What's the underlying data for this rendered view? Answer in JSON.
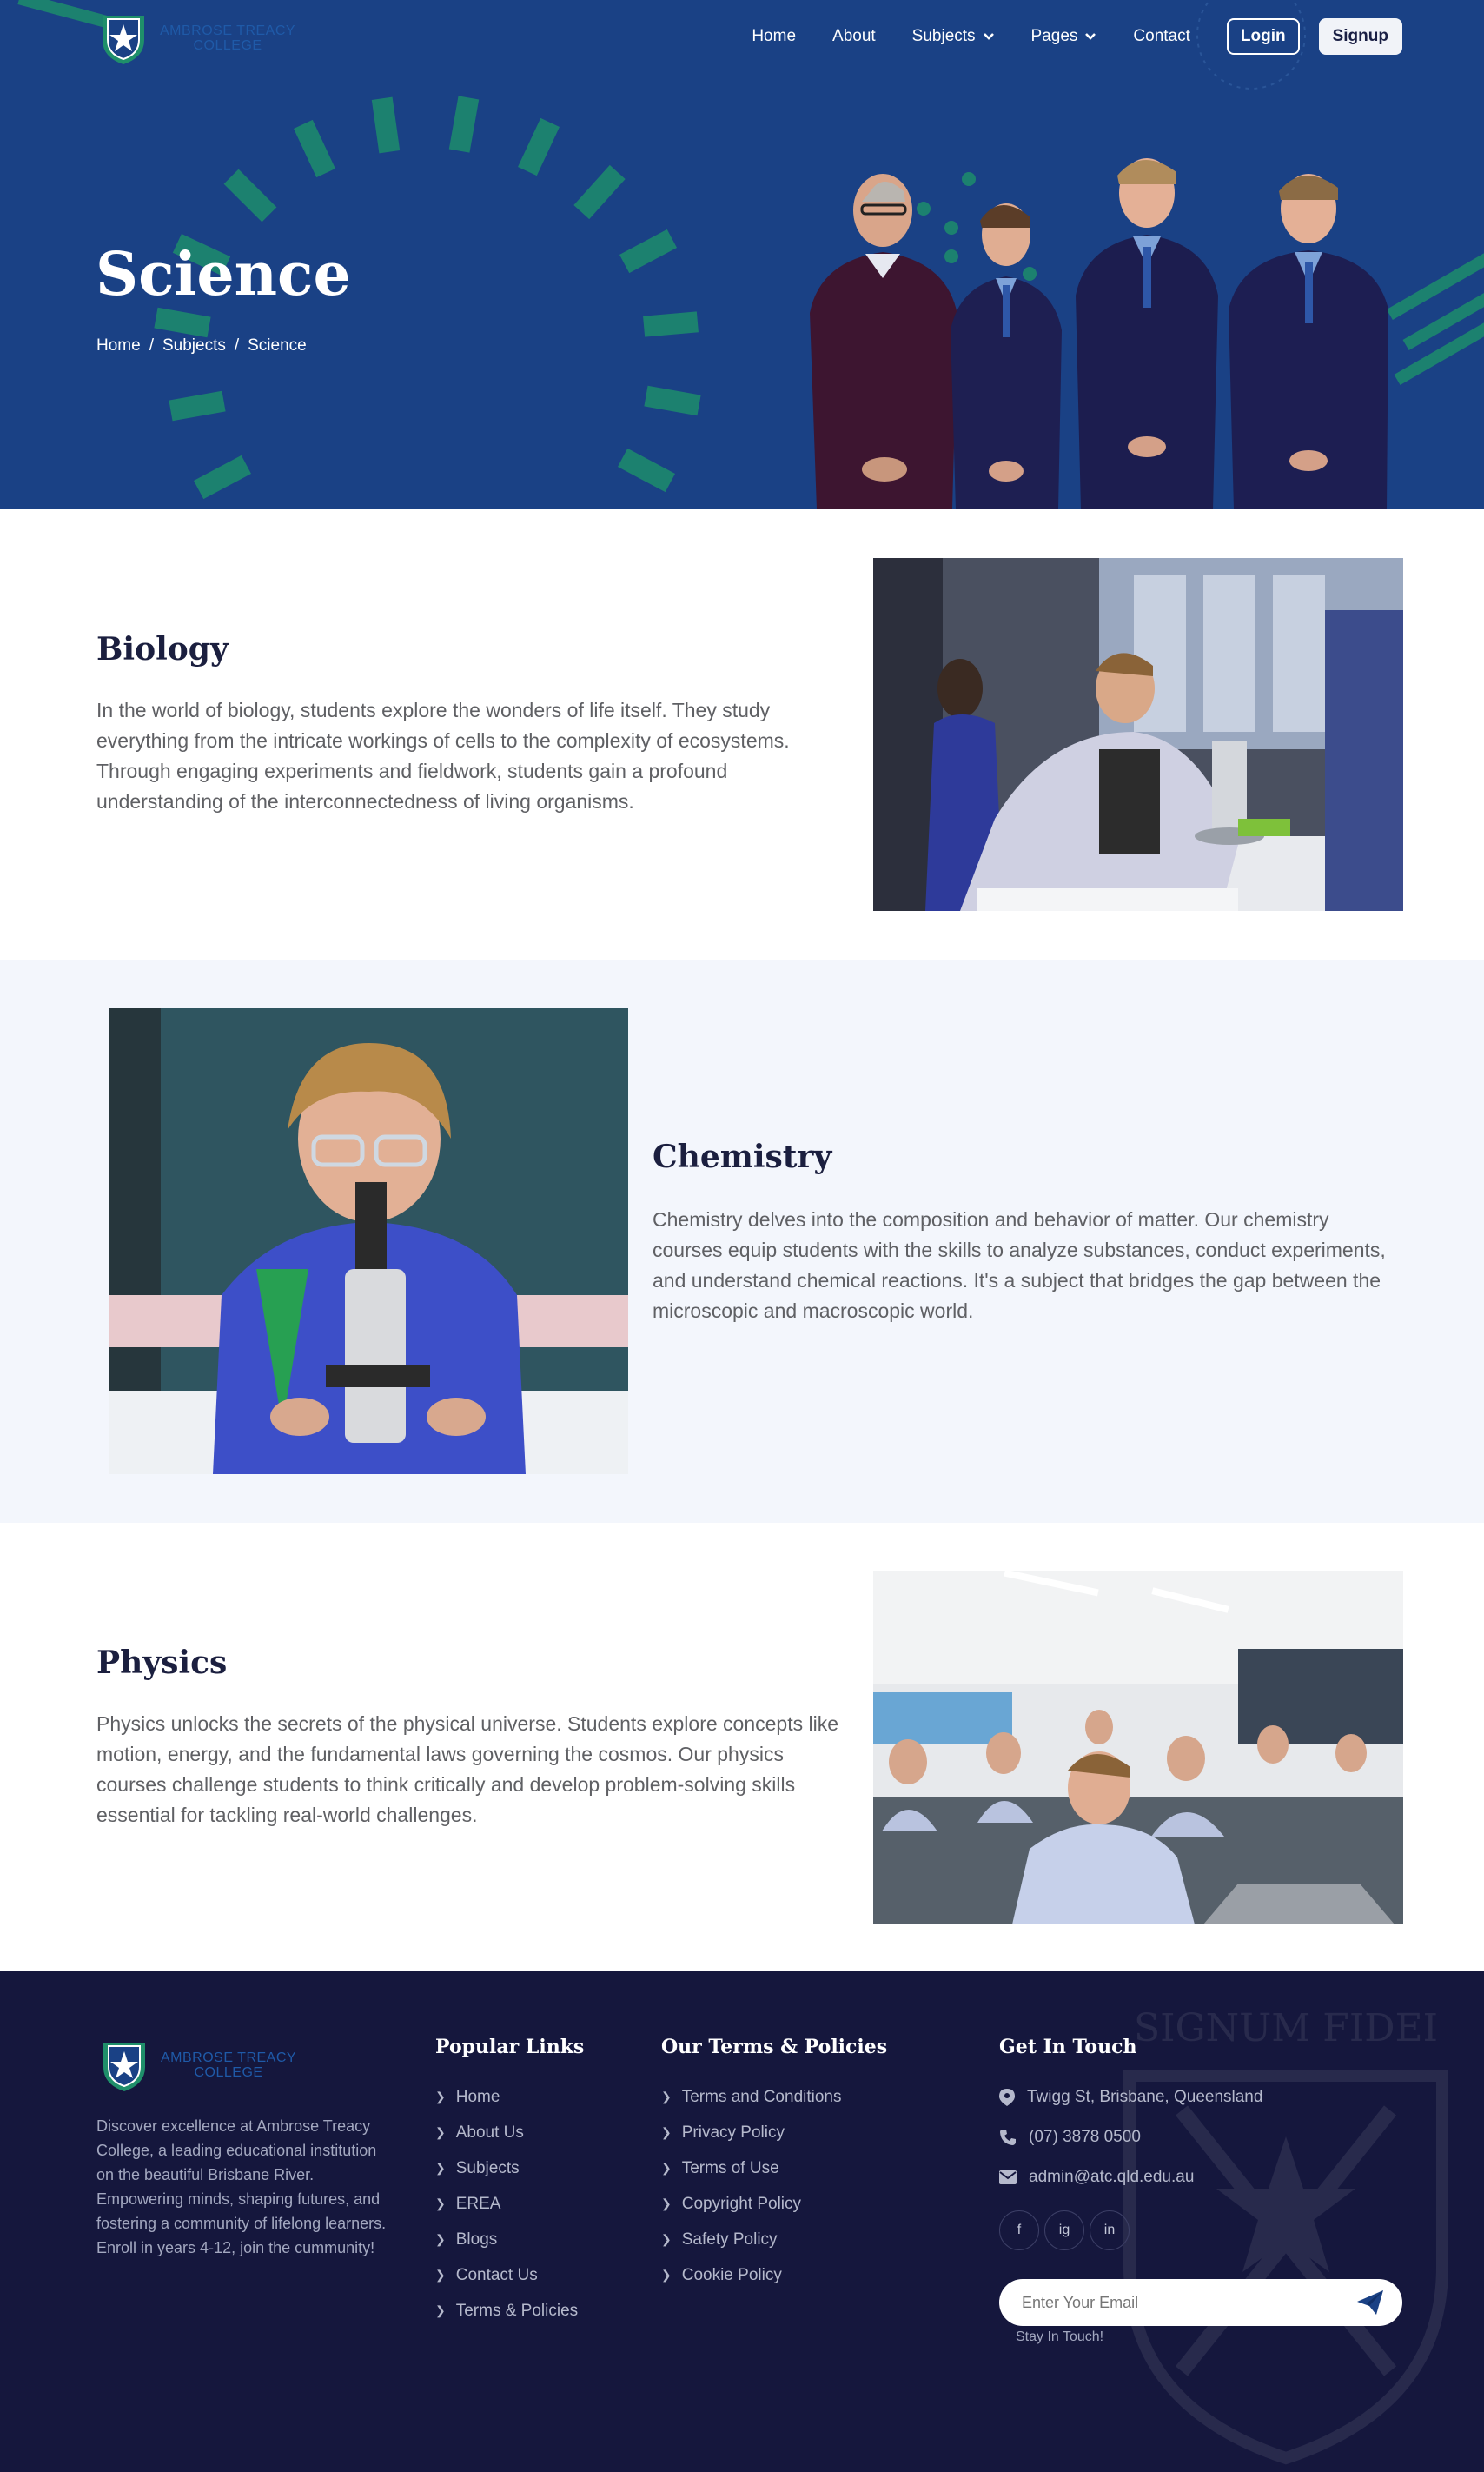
{
  "brand": {
    "name_line1": "AMBROSE TREACY",
    "name_line2": "COLLEGE"
  },
  "nav": {
    "links": [
      "Home",
      "About",
      "Subjects",
      "Pages",
      "Contact"
    ],
    "login": "Login",
    "signup": "Signup"
  },
  "hero": {
    "title": "Science",
    "breadcrumb": [
      "Home",
      "Subjects",
      "Science"
    ],
    "separator": "/"
  },
  "sections": [
    {
      "title": "Biology",
      "text": "In the world of biology, students explore the wonders of life itself. They study everything from the intricate workings of cells to the complexity of ecosystems. Through engaging experiments and fieldwork, students gain a profound understanding of the interconnectedness of living organisms."
    },
    {
      "title": "Chemistry",
      "text": "Chemistry delves into the composition and behavior of matter. Our chemistry courses equip students with the skills to analyze substances, conduct experiments, and understand chemical reactions. It's a subject that bridges the gap between the microscopic and macroscopic world."
    },
    {
      "title": "Physics",
      "text": "Physics unlocks the secrets of the physical universe. Students explore concepts like motion, energy, and the fundamental laws governing the cosmos. Our physics courses challenge students to think critically and develop problem-solving skills essential for tackling real-world challenges."
    }
  ],
  "footer": {
    "about": "Discover excellence at Ambrose Treacy College, a leading educational institution on the beautiful Brisbane River. Empowering minds, shaping futures, and fostering a community of lifelong learners. Enroll in years 4-12, join the cummunity!",
    "popular_title": "Popular Links",
    "popular_links": [
      "Home",
      "About Us",
      "Subjects",
      "EREA",
      "Blogs",
      "Contact Us",
      "Terms & Policies"
    ],
    "terms_title": "Our Terms & Policies",
    "terms_links": [
      "Terms and Conditions",
      "Privacy Policy",
      "Terms of Use",
      "Copyright Policy",
      "Safety Policy",
      "Cookie Policy"
    ],
    "contact_title": "Get In Touch",
    "address": "Twigg St, Brisbane, Queensland",
    "phone": "(07) 3878 0500",
    "email": "admin@atc.qld.edu.au",
    "social": [
      "f",
      "ig",
      "in"
    ],
    "email_placeholder": "Enter Your Email",
    "stay_in_touch": "Stay In Touch!",
    "watermark_text": "SIGNUM FIDEI"
  },
  "colors": {
    "hero_blue": "#1a4185",
    "accent_green": "#1f8f6a",
    "footer_navy": "#15173d",
    "alt_section_bg": "#f3f6fc",
    "heading_dark": "#1b1f3f"
  }
}
